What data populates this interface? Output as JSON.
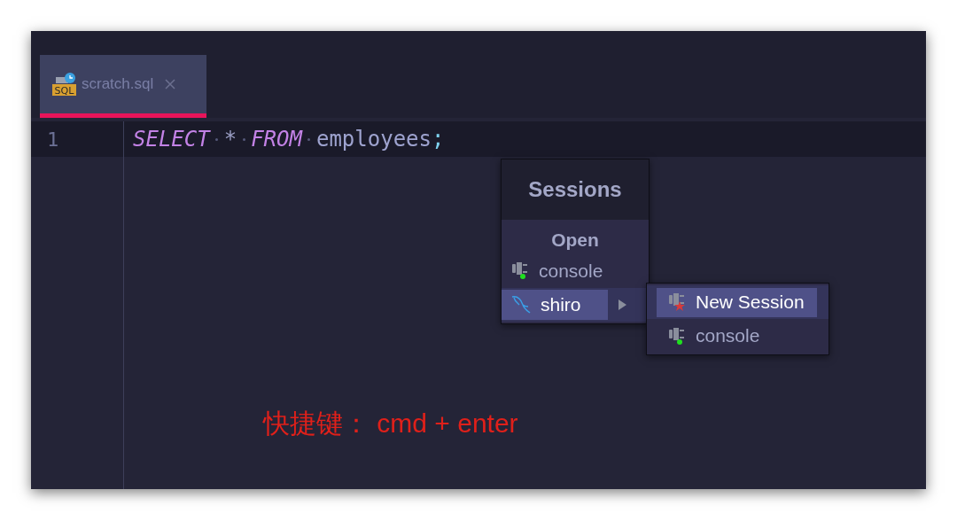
{
  "tabs": [
    {
      "label": "scratch.sql",
      "file_type": "SQL",
      "selected": true
    }
  ],
  "editor": {
    "lines": [
      {
        "number": "1",
        "current": true,
        "tokens": [
          {
            "text": "SELECT",
            "kind": "keyword"
          },
          {
            "text": "*",
            "kind": "operator"
          },
          {
            "text": "FROM",
            "kind": "keyword"
          },
          {
            "text": "employees",
            "kind": "identifier"
          },
          {
            "text": ";",
            "kind": "punct"
          }
        ]
      }
    ]
  },
  "sessions_popup": {
    "title": "Sessions",
    "section": "Open",
    "items": [
      {
        "label": "console",
        "kind": "console",
        "selected": false,
        "has_submenu": false
      },
      {
        "label": "shiro",
        "kind": "datasource",
        "selected": true,
        "has_submenu": true
      }
    ]
  },
  "submenu": {
    "items": [
      {
        "label": "New Session",
        "kind": "new",
        "selected": true
      },
      {
        "label": "console",
        "kind": "console",
        "selected": false
      }
    ]
  },
  "annotation": {
    "text": "快捷键： cmd + enter"
  }
}
